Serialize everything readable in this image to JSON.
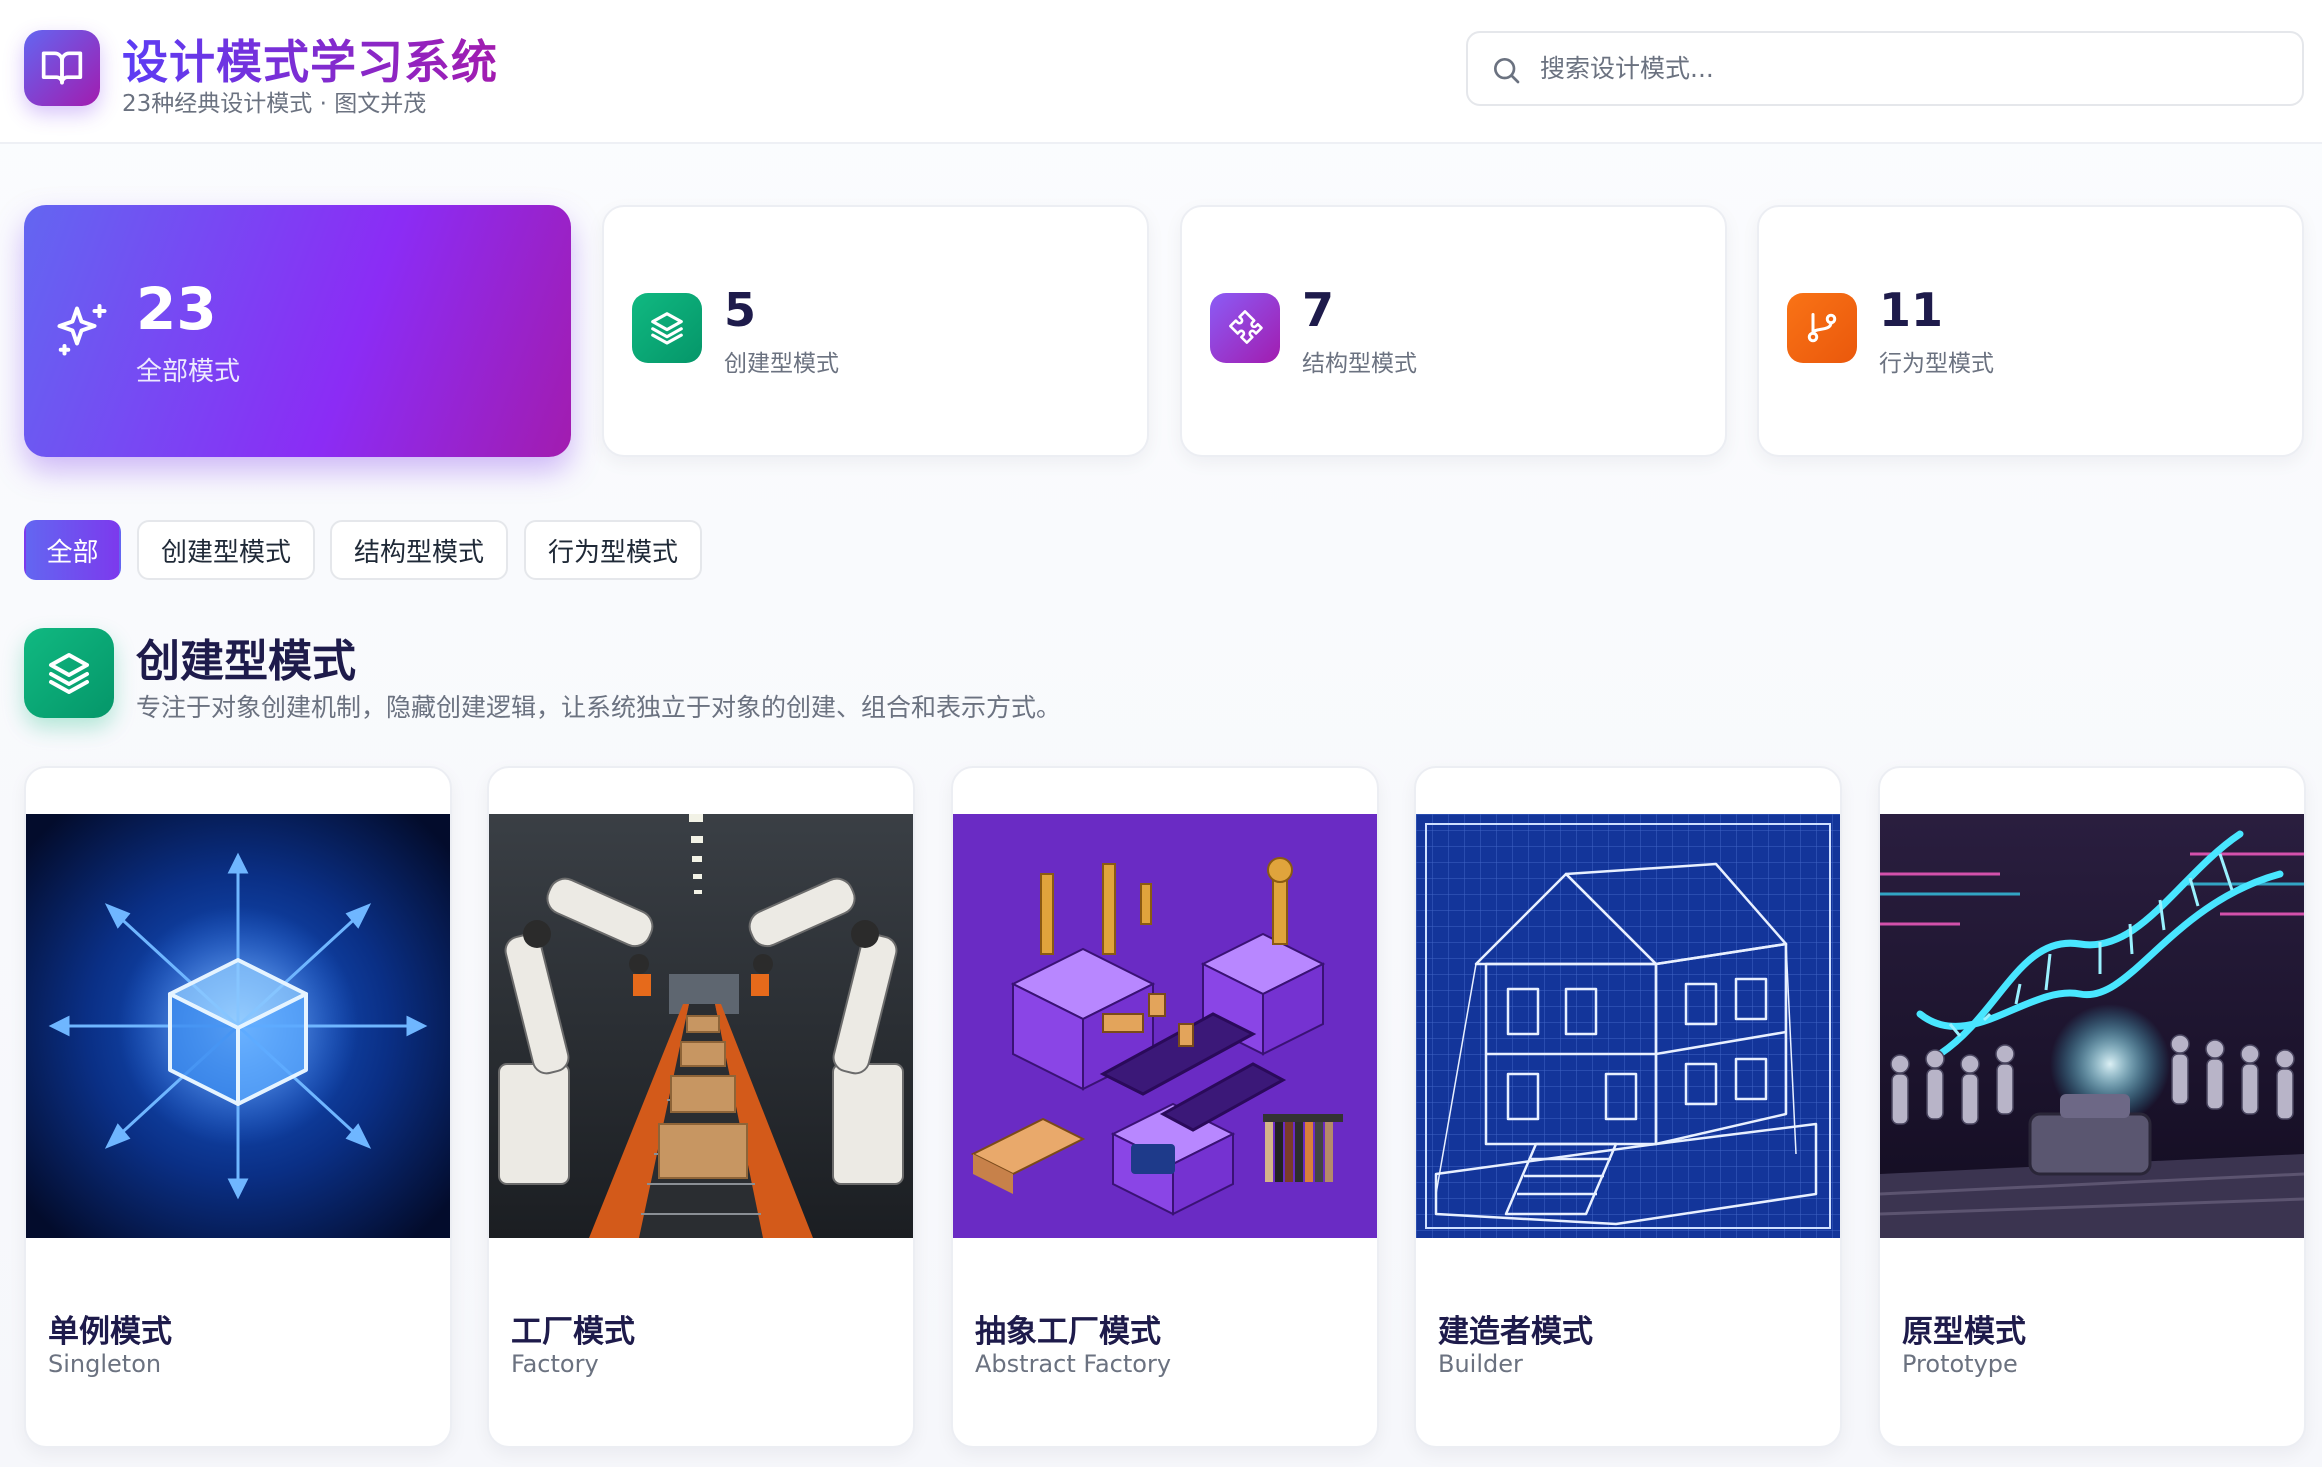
{
  "header": {
    "title": "设计模式学习系统",
    "subtitle": "23种经典设计模式 · 图文并茂",
    "logo_icon": "book-open-icon",
    "search": {
      "placeholder": "搜索设计模式...",
      "value": "",
      "icon": "search-icon"
    }
  },
  "stats": [
    {
      "value": "23",
      "label": "全部模式",
      "icon": "sparkles-icon",
      "active": true
    },
    {
      "value": "5",
      "label": "创建型模式",
      "icon": "layers-icon",
      "color": "#10b981"
    },
    {
      "value": "7",
      "label": "结构型模式",
      "icon": "puzzle-icon",
      "color": "#8b5cf6"
    },
    {
      "value": "11",
      "label": "行为型模式",
      "icon": "git-branch-icon",
      "color": "#f97316"
    }
  ],
  "filter_tabs": [
    {
      "label": "全部",
      "active": true
    },
    {
      "label": "创建型模式",
      "active": false
    },
    {
      "label": "结构型模式",
      "active": false
    },
    {
      "label": "行为型模式",
      "active": false
    }
  ],
  "section": {
    "title": "创建型模式",
    "description": "专注于对象创建机制，隐藏创建逻辑，让系统独立于对象的创建、组合和表示方式。",
    "icon": "layers-icon"
  },
  "patterns": [
    {
      "name": "单例模式",
      "english": "Singleton",
      "image": "glowing-cube-image"
    },
    {
      "name": "工厂模式",
      "english": "Factory",
      "image": "factory-robots-image"
    },
    {
      "name": "抽象工厂模式",
      "english": "Abstract Factory",
      "image": "isometric-factories-image"
    },
    {
      "name": "建造者模式",
      "english": "Builder",
      "image": "house-blueprint-image"
    },
    {
      "name": "原型模式",
      "english": "Prototype",
      "image": "dna-clones-image"
    }
  ],
  "colors": {
    "brand_gradient_start": "#6366f1",
    "brand_gradient_end": "#a21caf",
    "creational": "#10b981",
    "structural": "#8b5cf6",
    "behavioral": "#f97316"
  }
}
